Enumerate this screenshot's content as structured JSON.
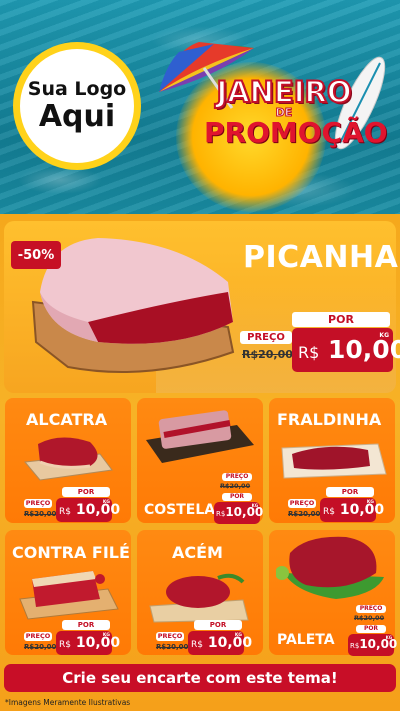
{
  "logo": {
    "line1": "Sua Logo",
    "line2": "Aqui"
  },
  "banner": {
    "line1": "JANEIRO",
    "line2": "DE",
    "line3": "PROMOÇÃO"
  },
  "featured": {
    "name": "PICANHA",
    "badge": "-50%",
    "preco_label": "PREÇO",
    "old_price": "R$20,00",
    "por_label": "POR",
    "currency": "R$",
    "price": "10,00",
    "unit": "KG"
  },
  "products": [
    {
      "name": "ALCATRA",
      "preco_label": "PREÇO",
      "old_price": "R$20,00",
      "por_label": "POR",
      "currency": "R$",
      "price": "10,00",
      "unit": "KG"
    },
    {
      "name": "COSTELA",
      "preco_label": "PREÇO",
      "old_price": "R$20,00",
      "por_label": "POR",
      "currency": "R$",
      "price": "10,00",
      "unit": "KG"
    },
    {
      "name": "FRALDINHA",
      "preco_label": "PREÇO",
      "old_price": "R$20,00",
      "por_label": "POR",
      "currency": "R$",
      "price": "10,00",
      "unit": "KG"
    },
    {
      "name": "CONTRA FILÉ",
      "preco_label": "PREÇO",
      "old_price": "R$20,00",
      "por_label": "POR",
      "currency": "R$",
      "price": "10,00",
      "unit": "KG"
    },
    {
      "name": "ACÉM",
      "preco_label": "PREÇO",
      "old_price": "R$20,00",
      "por_label": "POR",
      "currency": "R$",
      "price": "10,00",
      "unit": "KG"
    },
    {
      "name": "PALETA",
      "preco_label": "PREÇO",
      "old_price": "R$20,00",
      "por_label": "POR",
      "currency": "R$",
      "price": "10,00",
      "unit": "KG"
    }
  ],
  "cta": "Crie seu encarte com este tema!",
  "disclaimer": "*Imagens Meramente Ilustrativas",
  "colors": {
    "accent_red": "#c40f26",
    "card_orange": "#ff8a12",
    "banner_yellow": "#ffc02e",
    "logo_ring": "#ffd21a"
  }
}
